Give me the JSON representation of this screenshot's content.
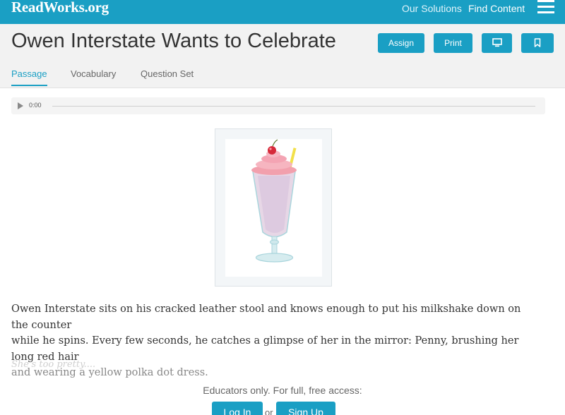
{
  "header": {
    "logo": "ReadWorks.org",
    "nav": [
      "Our Solutions",
      "Find Content"
    ],
    "menu_icon": "hamburger-icon"
  },
  "title_bar": {
    "title": "Owen Interstate Wants to Celebrate",
    "buttons": {
      "assign": "Assign",
      "print": "Print",
      "present_icon": "monitor-icon",
      "bookmark_icon": "bookmark-icon"
    },
    "tabs": [
      {
        "label": "Passage",
        "active": true
      },
      {
        "label": "Vocabulary",
        "active": false
      },
      {
        "label": "Question Set",
        "active": false
      }
    ]
  },
  "audio": {
    "play_icon": "play-icon",
    "time": "0:00",
    "progress": 0
  },
  "figure": {
    "image": "milkshake-illustration"
  },
  "passage": {
    "line1": "Owen Interstate sits on his cracked leather stool and knows enough to put his milkshake down on the counter",
    "line2": "while he spins. Every few seconds, he catches a glimpse of her in the mirror: Penny, brushing her long red hair",
    "line3": "and wearing a yellow polka dot dress.",
    "faded": "She's too pretty...."
  },
  "gate": {
    "message": "Educators only. For full, free access:",
    "login": "Log In",
    "or": "or",
    "signup": "Sign Up"
  },
  "colors": {
    "brand": "#1a9fc4",
    "title_bar_bg": "#f2f2f2"
  }
}
